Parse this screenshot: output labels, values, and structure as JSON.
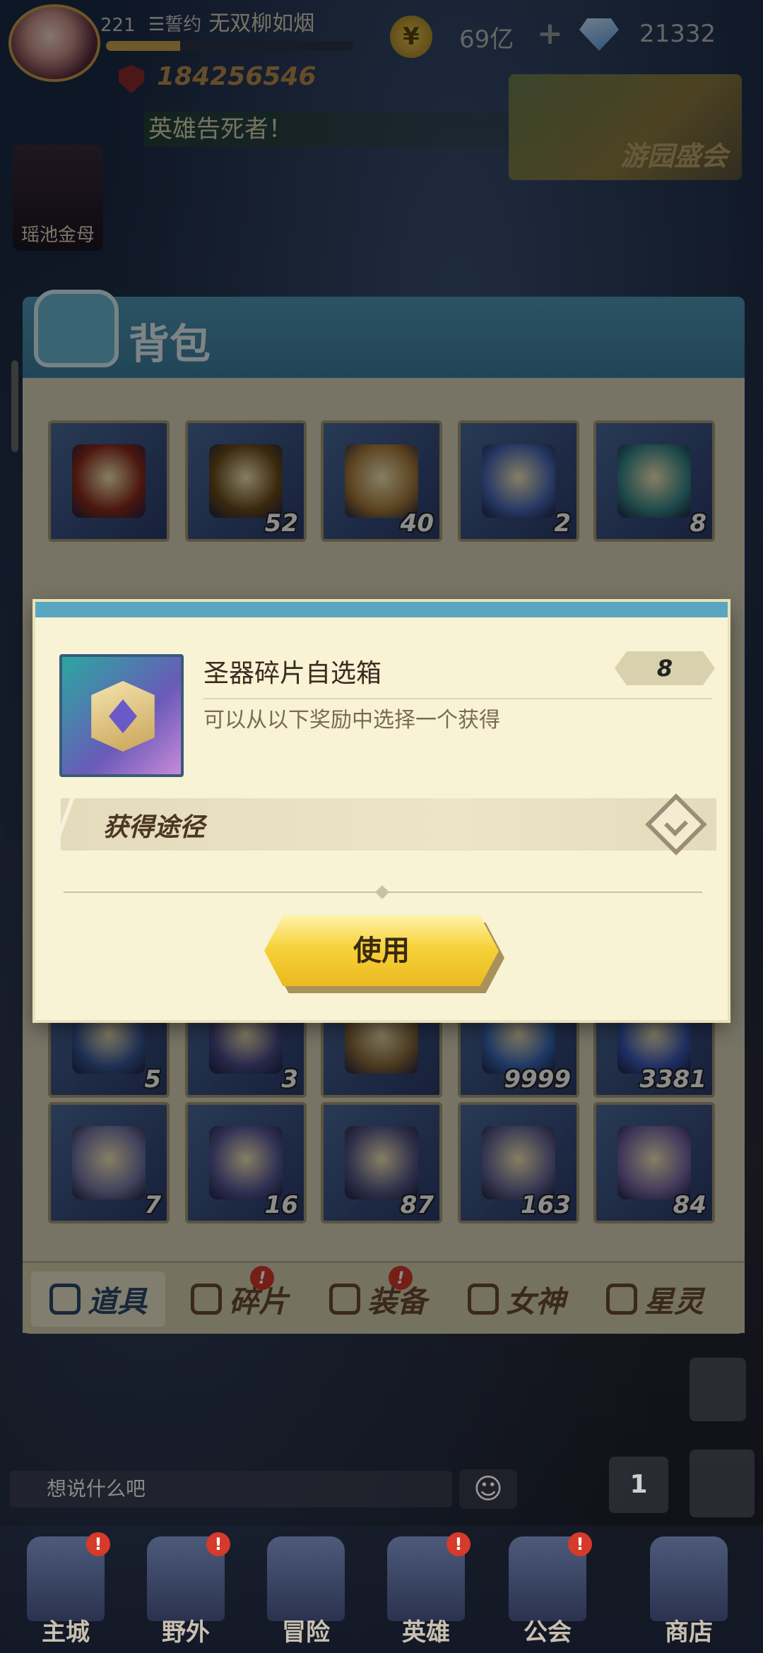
{
  "player": {
    "level": "221",
    "guild_tag": "☰誓约",
    "name": "无双柳如烟",
    "power": "184256546",
    "exp_progress": 0.3
  },
  "currency": {
    "gold": "69亿",
    "gems": "21332"
  },
  "announcement": "英雄告死者！",
  "event_banner": "游园盛会",
  "side_hero": "瑶池金母",
  "bag": {
    "title": "背包",
    "rows": [
      [
        {
          "count": "",
          "color": "#8a2a1a"
        },
        {
          "count": "52",
          "color": "#6a4a1a"
        },
        {
          "count": "40",
          "color": "#a87a3a"
        },
        {
          "count": "2",
          "color": "#4a6ab8"
        },
        {
          "count": "8",
          "color": "#3a8a8a"
        }
      ],
      [
        {
          "count": "5",
          "color": "#3a5a9a"
        },
        {
          "count": "3",
          "color": "#4a4a8a"
        },
        {
          "count": "",
          "color": "#8a6a3a"
        },
        {
          "count": "9999",
          "color": "#3a6ab8"
        },
        {
          "count": "3381",
          "color": "#3a5ab8"
        }
      ],
      [
        {
          "count": "7",
          "color": "#7a7aaa"
        },
        {
          "count": "16",
          "color": "#5a5a9a"
        },
        {
          "count": "87",
          "color": "#5a5a8a"
        },
        {
          "count": "163",
          "color": "#6a6a9a"
        },
        {
          "count": "84",
          "color": "#7a6aa8"
        }
      ]
    ],
    "tabs": [
      {
        "label": "道具",
        "active": true,
        "badge": ""
      },
      {
        "label": "碎片",
        "active": false,
        "badge": "!"
      },
      {
        "label": "装备",
        "active": false,
        "badge": "!"
      },
      {
        "label": "女神",
        "active": false,
        "badge": ""
      },
      {
        "label": "星灵",
        "active": false,
        "badge": ""
      }
    ]
  },
  "dialog": {
    "item_name": "圣器碎片自选箱",
    "item_count": "8",
    "description": "可以从以下奖励中选择一个获得",
    "source_title": "获得途径",
    "use_button": "使用"
  },
  "chat": {
    "placeholder": "想说什么吧"
  },
  "rank_label": "1",
  "nav": [
    {
      "label": "主城",
      "badge": "!"
    },
    {
      "label": "野外",
      "badge": "!"
    },
    {
      "label": "冒险",
      "badge": ""
    },
    {
      "label": "英雄",
      "badge": "!"
    },
    {
      "label": "公会",
      "badge": "!"
    },
    {
      "label": "商店",
      "badge": ""
    }
  ],
  "colors": {
    "accent_blue": "#5aa6c0",
    "button_yellow": "#f6d23a",
    "badge_red": "#d63a2a"
  }
}
